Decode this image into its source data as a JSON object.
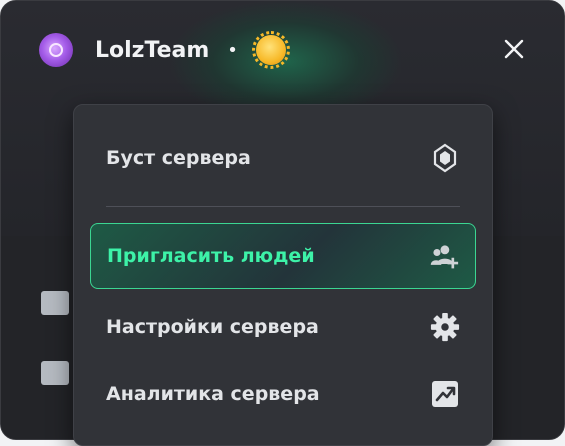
{
  "header": {
    "server_name": "LolzTeam",
    "separator": "•",
    "server_icon": "server-avatar-icon",
    "emoji_icon": "sun-emoji-icon",
    "close_icon": "close-icon"
  },
  "menu": {
    "items": [
      {
        "label": "Буст сервера",
        "icon": "boost-gem-icon"
      },
      {
        "label": "Пригласить людей",
        "icon": "add-person-icon",
        "active": true
      },
      {
        "label": "Настройки сервера",
        "icon": "gear-icon"
      },
      {
        "label": "Аналитика сервера",
        "icon": "analytics-chart-icon"
      }
    ]
  },
  "colors": {
    "accent": "#3df2a8",
    "menu_bg": "#313338",
    "text": "#e3e5e8"
  }
}
